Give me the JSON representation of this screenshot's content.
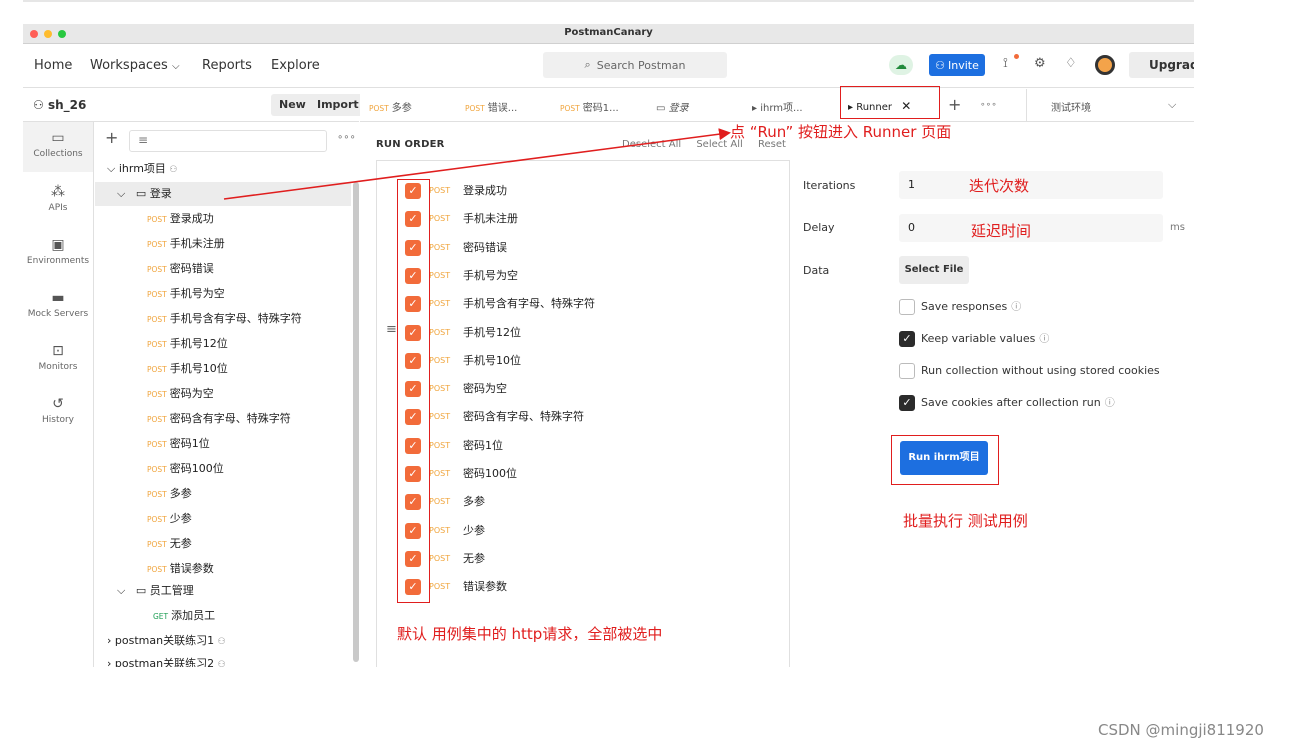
{
  "window": {
    "title": "PostmanCanary"
  },
  "header": {
    "nav": [
      "Home",
      "Workspaces",
      "Reports",
      "Explore"
    ],
    "search_placeholder": "Search Postman",
    "invite_label": "Invite",
    "upgrade_label": "Upgrade"
  },
  "workspace": {
    "name": "sh_26",
    "new_label": "New",
    "import_label": "Import"
  },
  "rail": [
    {
      "label": "Collections",
      "icon": "collections-icon"
    },
    {
      "label": "APIs",
      "icon": "apis-icon"
    },
    {
      "label": "Environments",
      "icon": "environments-icon"
    },
    {
      "label": "Mock Servers",
      "icon": "mock-servers-icon"
    },
    {
      "label": "Monitors",
      "icon": "monitors-icon"
    },
    {
      "label": "History",
      "icon": "history-icon"
    }
  ],
  "tree": {
    "collection": "ihrm项目",
    "folder1": "登录",
    "requests": [
      "登录成功",
      "手机未注册",
      "密码错误",
      "手机号为空",
      "手机号含有字母、特殊字符",
      "手机号12位",
      "手机号10位",
      "密码为空",
      "密码含有字母、特殊字符",
      "密码1位",
      "密码100位",
      "多参",
      "少参",
      "无参",
      "错误参数"
    ],
    "folder2": "员工管理",
    "get_request": "添加员工",
    "other_collections": [
      "postman关联练习1",
      "postman关联练习2"
    ],
    "method_post": "POST",
    "method_get": "GET"
  },
  "tabs": [
    {
      "method": "POST",
      "name": "多参"
    },
    {
      "method": "POST",
      "name": "错误..."
    },
    {
      "method": "POST",
      "name": "密码1..."
    },
    {
      "method": "",
      "name": "登录"
    },
    {
      "method": "",
      "name": "ihrm项..."
    },
    {
      "method": "",
      "name": "Runner"
    }
  ],
  "environment": "测试环境",
  "run_order": {
    "title": "RUN ORDER",
    "deselect_all": "Deselect All",
    "select_all": "Select All",
    "reset": "Reset",
    "items": [
      "登录成功",
      "手机未注册",
      "密码错误",
      "手机号为空",
      "手机号含有字母、特殊字符",
      "手机号12位",
      "手机号10位",
      "密码为空",
      "密码含有字母、特殊字符",
      "密码1位",
      "密码100位",
      "多参",
      "少参",
      "无参",
      "错误参数"
    ]
  },
  "settings": {
    "iterations_label": "Iterations",
    "iterations_value": "1",
    "delay_label": "Delay",
    "delay_value": "0",
    "delay_unit": "ms",
    "data_label": "Data",
    "select_file_label": "Select File",
    "options": [
      {
        "label": "Save responses",
        "checked": false,
        "info": true
      },
      {
        "label": "Keep variable values",
        "checked": true,
        "info": true
      },
      {
        "label": "Run collection without using stored cookies",
        "checked": false,
        "info": false
      },
      {
        "label": "Save cookies after collection run",
        "checked": true,
        "info": true
      }
    ],
    "run_button": "Run ihrm项目"
  },
  "annotations": {
    "runner_hint": "点 “Run” 按钮进入 Runner 页面",
    "iterations_hint": "迭代次数",
    "delay_hint": "延迟时间",
    "batch_hint": "批量执行  测试用例",
    "default_hint": "默认  用例集中的 http请求，全部被选中"
  },
  "watermark": "CSDN @mingji811920"
}
